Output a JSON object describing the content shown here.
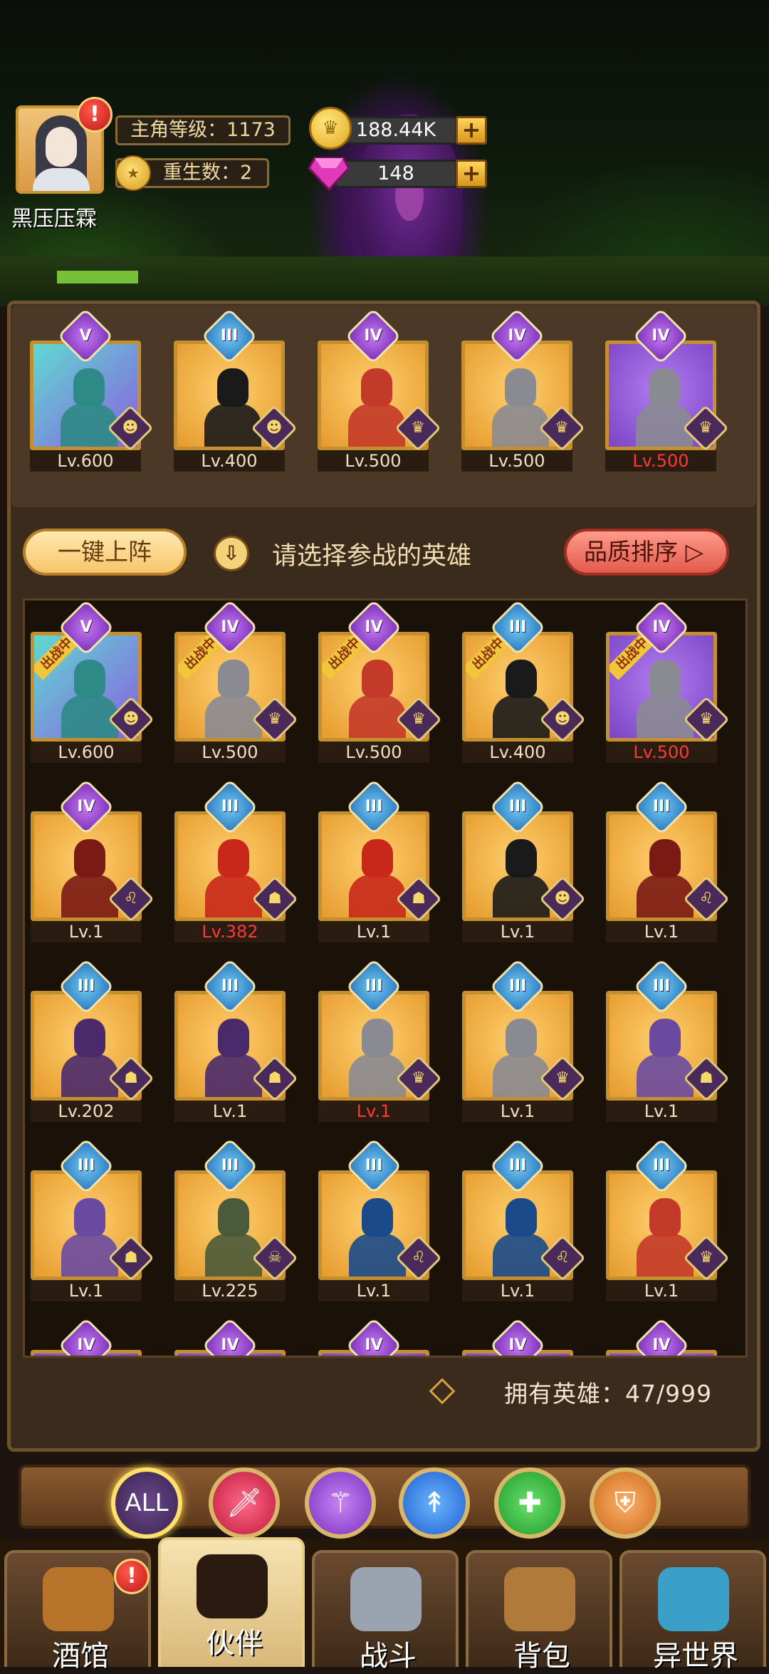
{
  "player": {
    "name": "黑压压霖",
    "alert": "!",
    "level_label": "主角等级：1173",
    "rebirth_label": "重生数：2",
    "rebirth_icon": "star-coin-icon"
  },
  "currency": {
    "gold": "188.44K",
    "gems": "148",
    "plus": "+"
  },
  "team": [
    {
      "rank": "V",
      "level": "Lv.600",
      "bg": "cyan",
      "figure": "#2d8a86",
      "cls": "ghost-icon",
      "red": false
    },
    {
      "rank": "III",
      "level": "Lv.400",
      "bg": "gold",
      "figure": "#1a1a1a",
      "cls": "ghost-icon",
      "red": false
    },
    {
      "rank": "IV",
      "level": "Lv.500",
      "bg": "gold",
      "figure": "#c43a2a",
      "cls": "crown-icon",
      "red": false
    },
    {
      "rank": "IV",
      "level": "Lv.500",
      "bg": "gold",
      "figure": "#8a8a92",
      "cls": "crown-icon",
      "red": false
    },
    {
      "rank": "IV",
      "level": "Lv.500",
      "bg": "purple",
      "figure": "#8a8a92",
      "cls": "crown-icon",
      "red": true
    }
  ],
  "controls": {
    "one_click": "一键上阵",
    "hint": "请选择参战的英雄",
    "sort": "品质排序 ▷",
    "download_icon": "⇩"
  },
  "deploy_tag": "出战中",
  "heroes": [
    {
      "rank": "V",
      "level": "Lv.600",
      "bg": "cyan",
      "figure": "#2d8a86",
      "cls": "ghost-icon",
      "red": false,
      "deployed": true
    },
    {
      "rank": "IV",
      "level": "Lv.500",
      "bg": "gold",
      "figure": "#8a8a92",
      "cls": "crown-icon",
      "red": false,
      "deployed": true
    },
    {
      "rank": "IV",
      "level": "Lv.500",
      "bg": "gold",
      "figure": "#c43a2a",
      "cls": "crown-icon",
      "red": false,
      "deployed": true
    },
    {
      "rank": "III",
      "level": "Lv.400",
      "bg": "gold",
      "figure": "#1a1a1a",
      "cls": "ghost-icon",
      "red": false,
      "deployed": true
    },
    {
      "rank": "IV",
      "level": "Lv.500",
      "bg": "purple",
      "figure": "#8a8a92",
      "cls": "crown-icon",
      "red": true,
      "deployed": true
    },
    {
      "rank": "IV",
      "level": "Lv.1",
      "bg": "gold",
      "figure": "#7a1a14",
      "cls": "lion-icon",
      "red": false,
      "deployed": false
    },
    {
      "rank": "III",
      "level": "Lv.382",
      "bg": "gold",
      "figure": "#c8281a",
      "cls": "demon-icon",
      "red": true,
      "deployed": false
    },
    {
      "rank": "III",
      "level": "Lv.1",
      "bg": "gold",
      "figure": "#c8281a",
      "cls": "demon-icon",
      "red": false,
      "deployed": false
    },
    {
      "rank": "III",
      "level": "Lv.1",
      "bg": "gold",
      "figure": "#1a1a1a",
      "cls": "ghost-icon",
      "red": false,
      "deployed": false
    },
    {
      "rank": "III",
      "level": "Lv.1",
      "bg": "gold",
      "figure": "#7a1a14",
      "cls": "lion-icon",
      "red": false,
      "deployed": false
    },
    {
      "rank": "III",
      "level": "Lv.202",
      "bg": "gold",
      "figure": "#4a2a6a",
      "cls": "demon-icon",
      "red": false,
      "deployed": false
    },
    {
      "rank": "III",
      "level": "Lv.1",
      "bg": "gold",
      "figure": "#4a2a6a",
      "cls": "demon-icon",
      "red": false,
      "deployed": false
    },
    {
      "rank": "III",
      "level": "Lv.1",
      "bg": "gold",
      "figure": "#8a8a92",
      "cls": "crown-icon",
      "red": true,
      "deployed": false
    },
    {
      "rank": "III",
      "level": "Lv.1",
      "bg": "gold",
      "figure": "#8a8a92",
      "cls": "crown-icon",
      "red": false,
      "deployed": false
    },
    {
      "rank": "III",
      "level": "Lv.1",
      "bg": "gold",
      "figure": "#6a4aa0",
      "cls": "demon-icon",
      "red": false,
      "deployed": false
    },
    {
      "rank": "III",
      "level": "Lv.1",
      "bg": "gold",
      "figure": "#6a4aa0",
      "cls": "demon-icon",
      "red": false,
      "deployed": false
    },
    {
      "rank": "III",
      "level": "Lv.225",
      "bg": "gold",
      "figure": "#4a5a3a",
      "cls": "skull-icon",
      "red": false,
      "deployed": false
    },
    {
      "rank": "III",
      "level": "Lv.1",
      "bg": "gold",
      "figure": "#1a4a8a",
      "cls": "lion-icon",
      "red": false,
      "deployed": false
    },
    {
      "rank": "III",
      "level": "Lv.1",
      "bg": "gold",
      "figure": "#1a4a8a",
      "cls": "lion-icon",
      "red": false,
      "deployed": false
    },
    {
      "rank": "III",
      "level": "Lv.1",
      "bg": "gold",
      "figure": "#c43a2a",
      "cls": "crown-icon",
      "red": false,
      "deployed": false
    },
    {
      "rank": "IV",
      "level": "",
      "bg": "purple",
      "figure": "#8a5ac0",
      "cls": "",
      "red": false,
      "deployed": false
    },
    {
      "rank": "IV",
      "level": "",
      "bg": "purple",
      "figure": "#8a5ac0",
      "cls": "",
      "red": false,
      "deployed": false
    },
    {
      "rank": "IV",
      "level": "",
      "bg": "purple",
      "figure": "#8a5ac0",
      "cls": "",
      "red": false,
      "deployed": false
    },
    {
      "rank": "IV",
      "level": "",
      "bg": "purple",
      "figure": "#8a5ac0",
      "cls": "",
      "red": false,
      "deployed": false
    },
    {
      "rank": "IV",
      "level": "",
      "bg": "purple",
      "figure": "#8a5ac0",
      "cls": "",
      "red": false,
      "deployed": false
    }
  ],
  "owned": "拥有英雄：47/999",
  "filters": [
    {
      "label": "ALL",
      "icon": "all-filter"
    },
    {
      "label": "",
      "icon": "sword-icon"
    },
    {
      "label": "",
      "icon": "staff-icon"
    },
    {
      "label": "",
      "icon": "dagger-icon"
    },
    {
      "label": "",
      "icon": "heal-cross-icon"
    },
    {
      "label": "",
      "icon": "shield-icon"
    }
  ],
  "nav": [
    {
      "label": "酒馆",
      "icon": "beer-mug-icon",
      "alert": "!",
      "active": false
    },
    {
      "label": "伙伴",
      "icon": "companion-face-icon",
      "alert": "",
      "active": true
    },
    {
      "label": "战斗",
      "icon": "crossed-swords-icon",
      "alert": "",
      "active": false
    },
    {
      "label": "背包",
      "icon": "treasure-chest-icon",
      "alert": "",
      "active": false
    },
    {
      "label": "异世界",
      "icon": "portal-icon",
      "alert": "",
      "active": false
    }
  ]
}
